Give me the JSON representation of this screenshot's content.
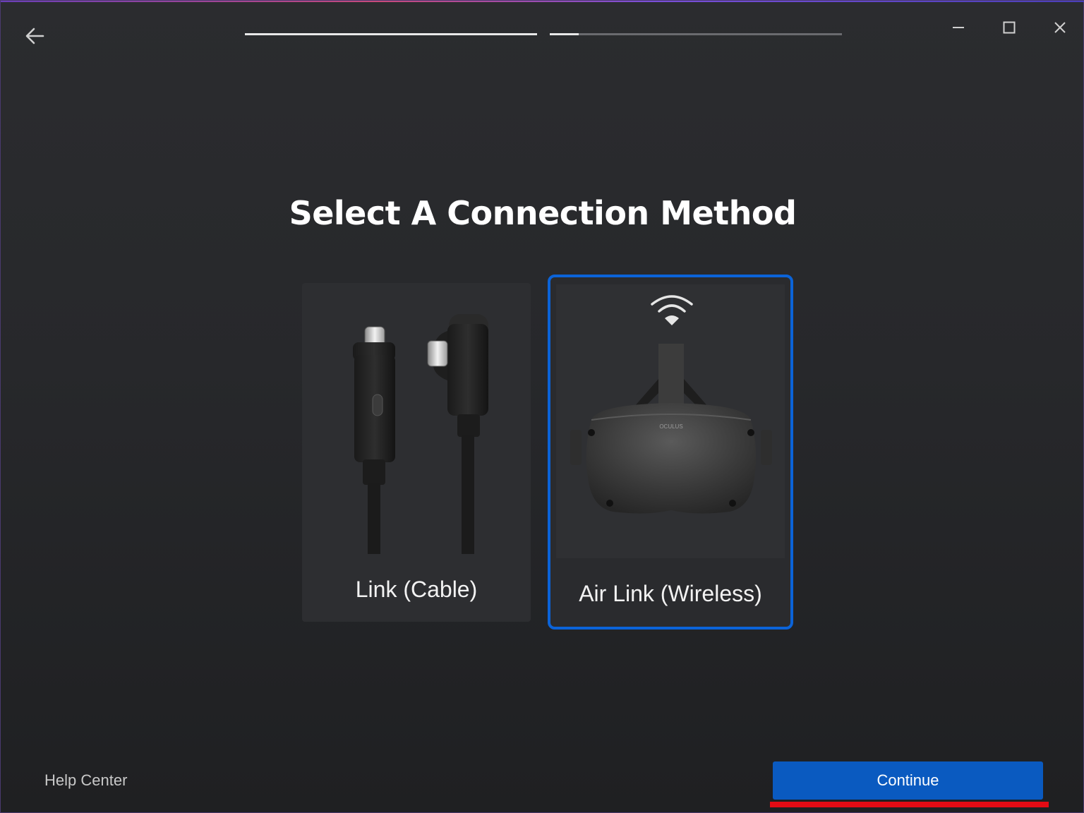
{
  "header": {
    "back_icon": "arrow-left-icon",
    "progress_steps": [
      {
        "fill_fraction": 1.0
      },
      {
        "fill_fraction": 0.1
      }
    ],
    "window_controls": [
      "minimize-icon",
      "maximize-icon",
      "close-icon"
    ]
  },
  "main": {
    "title": "Select A Connection Method",
    "options": [
      {
        "label": "Link (Cable)",
        "image": "usb-c-cable-image",
        "selected": false
      },
      {
        "label": "Air Link (Wireless)",
        "image": "vr-headset-image",
        "icon": "wifi-icon",
        "selected": true
      }
    ]
  },
  "footer": {
    "help_label": "Help Center",
    "continue_label": "Continue"
  },
  "colors": {
    "accent": "#0b63d8",
    "button": "#0a5ac0",
    "annotation": "#e40b14"
  }
}
